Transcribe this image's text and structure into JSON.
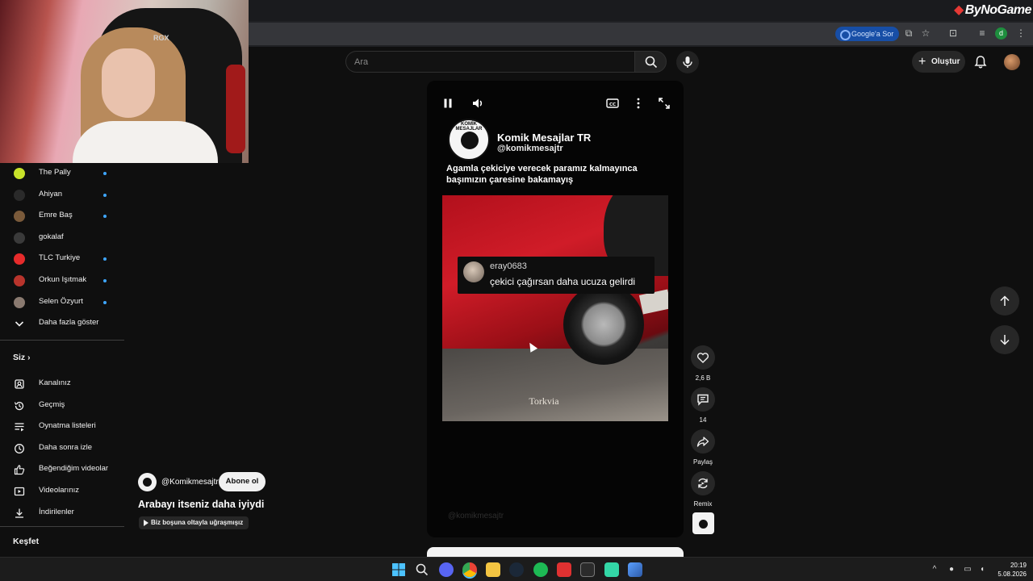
{
  "browser": {
    "brand": "ByNoGame",
    "google_sor": "Google'a Sor",
    "profile_initial": "d"
  },
  "webcam": {
    "chair_logo": "RGX"
  },
  "header": {
    "search_placeholder": "Ara",
    "create_label": "Oluştur"
  },
  "sidebar": {
    "subscriptions": [
      {
        "label": "The Pally",
        "live": true,
        "avatar_color": "#c8e22a"
      },
      {
        "label": "Ahiyan",
        "live": true,
        "avatar_color": "#2a2a2a"
      },
      {
        "label": "Emre Baş",
        "live": true,
        "avatar_color": "#7a5a3a"
      },
      {
        "label": "gokalaf",
        "live": false,
        "avatar_color": "#3a3a3a"
      },
      {
        "label": "TLC Turkiye",
        "live": true,
        "avatar_color": "#e62b2b"
      },
      {
        "label": "Orkun Işıtmak",
        "live": true,
        "avatar_color": "#b8342c"
      },
      {
        "label": "Selen Özyurt",
        "live": true,
        "avatar_color": "#8a7a70"
      }
    ],
    "show_more": "Daha fazla göster",
    "you_section": "Siz",
    "you_items": [
      {
        "label": "Kanalınız",
        "icon": "channel-icon"
      },
      {
        "label": "Geçmiş",
        "icon": "history-icon"
      },
      {
        "label": "Oynatma listeleri",
        "icon": "playlists-icon"
      },
      {
        "label": "Daha sonra izle",
        "icon": "watch-later-icon"
      },
      {
        "label": "Beğendiğim videolar",
        "icon": "like-icon"
      },
      {
        "label": "Videolarınız",
        "icon": "your-videos-icon"
      },
      {
        "label": "İndirilenler",
        "icon": "download-icon"
      }
    ],
    "explore_section": "Keşfet"
  },
  "short": {
    "channel_logo_text": "KOMİK MESAJLAR",
    "channel_name": "Komik Mesajlar TR",
    "channel_handle": "@komikmesajtr",
    "caption": "Agamla çekiciye verecek paramız kalmayınca başımızın çaresine bakamayış",
    "comment_user": "eray0683",
    "comment_text": "çekici çağırsan daha ucuza gelirdi",
    "watermark": "Torkvia",
    "faded_text": "@komikmesajtr"
  },
  "actions": {
    "likes": "2,6 B",
    "comments": "14",
    "share": "Paylaş",
    "remix": "Remix"
  },
  "overlay": {
    "handle": "@Komikmesajtr",
    "subscribe": "Abone ol",
    "title": "Arabayı itseniz daha iyiydi",
    "chip": "Biz boşuna oltayla uğraşmışız"
  },
  "taskbar": {
    "time": "20:19",
    "date": "5.08.2026"
  }
}
